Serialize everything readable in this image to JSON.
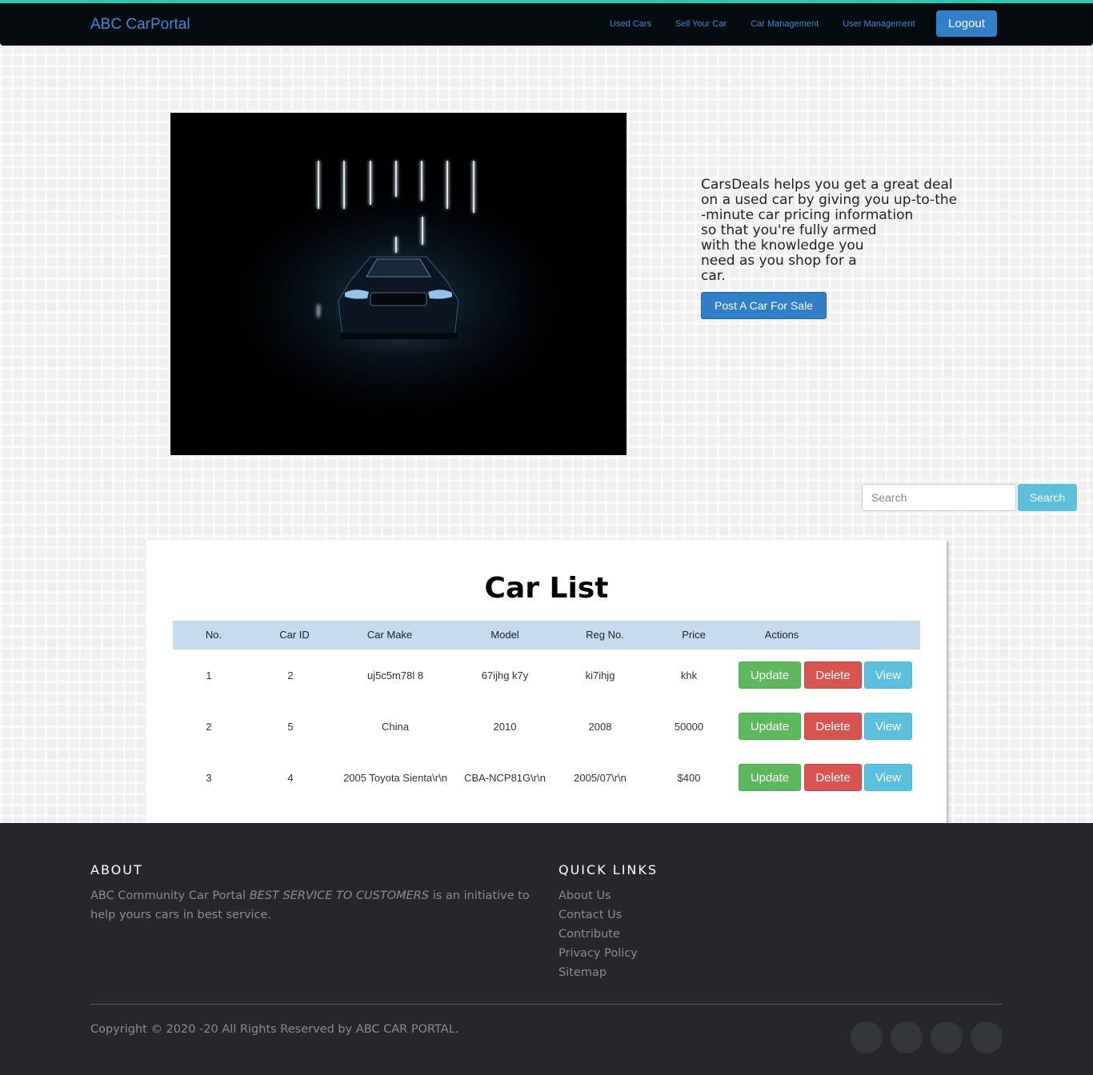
{
  "navbar": {
    "brand": "ABC CarPortal",
    "links": [
      "Used Cars",
      "Sell Your Car",
      "Car Management",
      "User Management"
    ],
    "logout_label": "Logout",
    "accent_color": "#2ac9b0"
  },
  "hero": {
    "image_icon": "car-hero-image",
    "text_lines": [
      "CarsDeals helps you get a great deal",
      "on a used car by giving you up-to-the",
      "-minute car pricing information",
      "so that you're fully armed",
      "with the knowledge you",
      "need as you shop for a",
      "car."
    ],
    "post_button_label": "Post A Car For Sale"
  },
  "search": {
    "placeholder": "Search",
    "button_label": "Search"
  },
  "table": {
    "title": "Car List",
    "headers": [
      "No.",
      "Car ID",
      "Car Make",
      "Model",
      "Reg No.",
      "Price",
      "Actions"
    ],
    "rows": [
      {
        "no": "1",
        "car_id": "2",
        "make": "uj5c5m78l 8",
        "model": "67ijhg k7y",
        "reg": "ki7ihjg",
        "price": "khk"
      },
      {
        "no": "2",
        "car_id": "5",
        "make": "China",
        "model": "2010",
        "reg": "2008",
        "price": "50000"
      },
      {
        "no": "3",
        "car_id": "4",
        "make": "2005 Toyota Sienta\\r\\n",
        "model": "CBA-NCP81G\\r\\n",
        "reg": "2005/07\\r\\n",
        "price": "$400"
      }
    ],
    "actions": {
      "update": "Update",
      "delete": "Delete",
      "view": "View"
    }
  },
  "footer": {
    "about_heading": "ABOUT",
    "about_prefix": "ABC Community Car Portal",
    "about_emphasis": "BEST SERVICE TO CUSTOMERS",
    "about_suffix": "is an initiative to help yours cars in best service.",
    "links_heading": "QUICK LINKS",
    "links": [
      "About Us",
      "Contact Us",
      "Contribute",
      "Privacy Policy",
      "Sitemap"
    ],
    "copyright": "Copyright © 2020 -20 All Rights Reserved by ABC CAR PORTAL.",
    "social_icons": [
      "social-icon-1",
      "social-icon-2",
      "social-icon-3",
      "social-icon-4"
    ]
  }
}
